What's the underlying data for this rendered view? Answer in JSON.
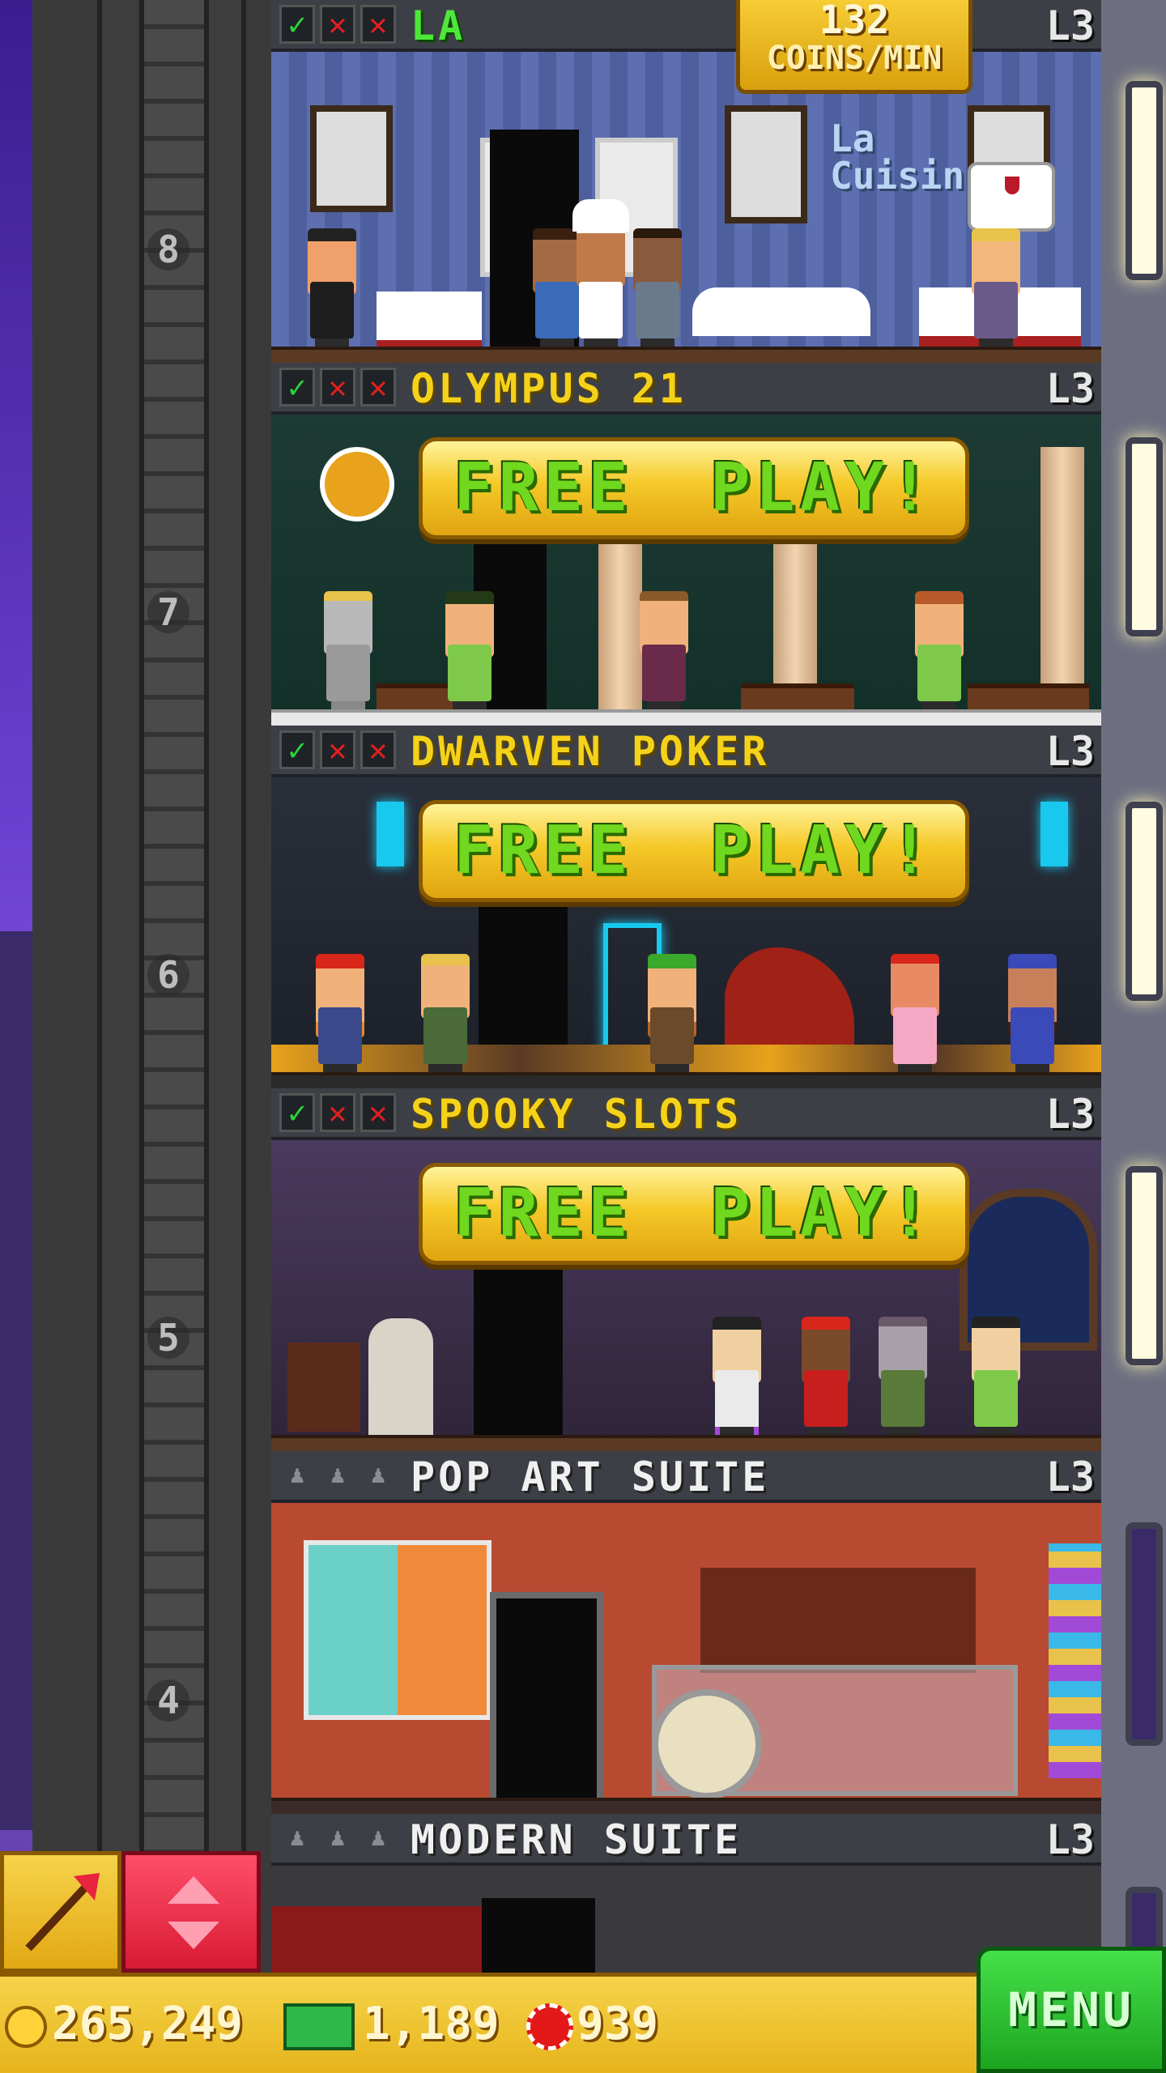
{
  "floors": [
    {
      "number": "8",
      "name": "LA",
      "level": "L3",
      "badge": {
        "value": "132",
        "unit": "COINS/MIN"
      }
    },
    {
      "number": "7",
      "name": "OLYMPUS 21",
      "level": "L3",
      "action": "FREE  PLAY!"
    },
    {
      "number": "6",
      "name": "DWARVEN POKER",
      "level": "L3",
      "action": "FREE  PLAY!"
    },
    {
      "number": "5",
      "name": "SPOOKY SLOTS",
      "level": "L3",
      "action": "FREE  PLAY!"
    },
    {
      "number": "4",
      "name": "POP ART SUITE",
      "level": "L3"
    },
    {
      "name": "MODERN SUITE",
      "level": "L3"
    }
  ],
  "sign_text": {
    "line1": "La",
    "line2": "Cuisin"
  },
  "resources": {
    "coins": "265,249",
    "bux": "1,189",
    "chips": "939"
  },
  "menu_label": "MENU",
  "colors": {
    "gold": "#f5d21a",
    "menu_green": "#2fc834",
    "elevator_red": "#e8243e",
    "freeplay_green": "#6fd81f"
  },
  "icons": {
    "check": "check-icon",
    "cross": "cross-icon",
    "staff": "staff-slot-icon",
    "tool": "raffle-wand-icon",
    "elevator": "elevator-arrows-icon",
    "coin": "coin-icon",
    "bux": "tower-bux-icon",
    "chip": "casino-chip-icon"
  }
}
